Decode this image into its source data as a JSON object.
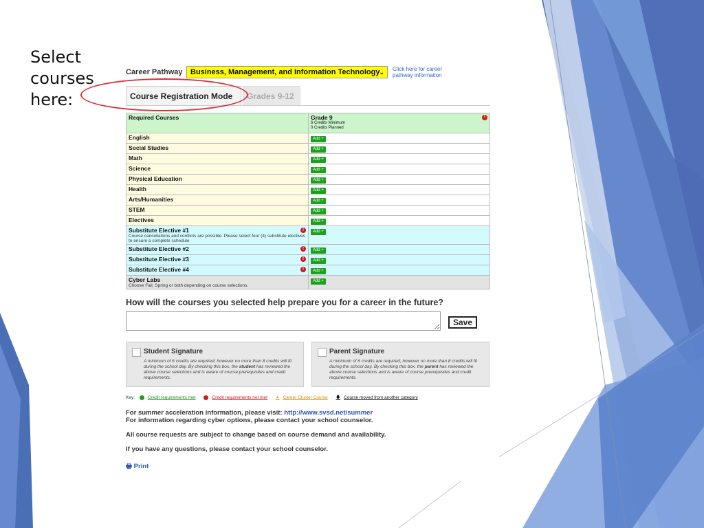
{
  "slide": {
    "title": "Select\ncourses\nhere:"
  },
  "pathway": {
    "label": "Career Pathway",
    "selected": "Business, Management, and Information Technology",
    "info_link": "Click here for career pathway information"
  },
  "tabs": [
    {
      "label": "Course Registration Mode"
    },
    {
      "label": "Grades 9-12"
    }
  ],
  "table": {
    "header_col1": "Required Courses",
    "grade": {
      "title": "Grade 9",
      "line1": "6 Credits Minimum",
      "line2": "0 Credits Planned"
    },
    "add_label": "Add +",
    "required": [
      "English",
      "Social Studies",
      "Math",
      "Science",
      "Physical Education",
      "Health",
      "Arts/Humanities",
      "STEM",
      "Electives"
    ],
    "substitute": [
      {
        "name": "Substitute Elective #1",
        "note": "Course cancellations and conflicts are possible. Please select four (4) substitute electives to ensure a complete schedule"
      },
      {
        "name": "Substitute Elective #2",
        "note": ""
      },
      {
        "name": "Substitute Elective #3",
        "note": ""
      },
      {
        "name": "Substitute Elective #4",
        "note": ""
      }
    ],
    "cyber": {
      "name": "Cyber Labs",
      "note": "Choose Fall, Spring or both depending on course selections."
    }
  },
  "question": "How will the courses you selected help prepare you for a career in the future?",
  "save_label": "Save",
  "signatures": {
    "student": {
      "title": "Student Signature",
      "text_pre": "A minimum of 6 credits are required; however no more than 8 credits will fit during the school day.  By checking this box, the ",
      "who": "student",
      "text_post": " has reviewed the above course selections and is aware of course prerequisites and credit requirements."
    },
    "parent": {
      "title": "Parent Signature",
      "text_pre": "A minimum of 6 credits are required; however no more than 8 credits will fit during the school day.  By checking this box, the ",
      "who": "parent",
      "text_post": " has reviewed the above course selections and is aware of course prerequisites and credit requirements."
    }
  },
  "key": {
    "label": "Key:",
    "met": "Credit requirements met",
    "not_met": "Credit requirements not met",
    "cluster": "Career Cluster Course",
    "moved": "Course moved from another category"
  },
  "info": {
    "summer_prefix": "For summer acceleration information, please visit: ",
    "summer_link": "http://www.svsd.net/summer",
    "cyber": "For information regarding cyber options, please contact your school counselor.",
    "change": "All course requests are subject to change based on course demand and availability.",
    "questions": "If you have any questions, please contact your school counselor."
  },
  "print_label": "Print",
  "colors": {
    "pathway_bg": "#ffff00",
    "required_row": "#fffbe0",
    "substitute_row": "#d3fbff",
    "header_row": "#ccf5cc",
    "add_button": "#1da01d",
    "warning": "#cc1a1a",
    "link": "#2c55b8",
    "theme_blue": "#4a6fb5"
  }
}
